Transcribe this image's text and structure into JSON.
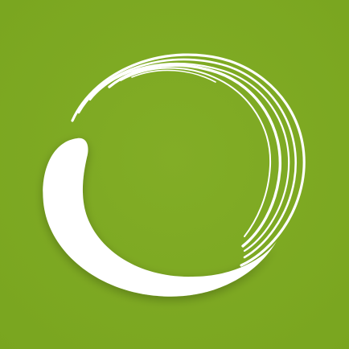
{
  "colors": {
    "background": "#79A51F",
    "background_light": "#82AD26",
    "stroke": "#FFFFFF"
  },
  "icon": {
    "name": "enso-circle-icon"
  }
}
